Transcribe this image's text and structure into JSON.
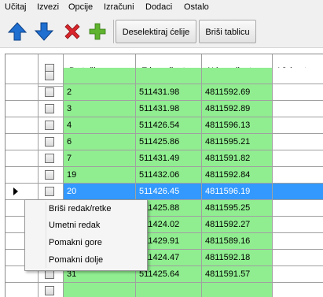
{
  "menu": [
    "Učitaj",
    "Izvezi",
    "Opcije",
    "Izračuni",
    "Dodaci",
    "Ostalo"
  ],
  "toolbar": {
    "icons": [
      "arrow-up-icon",
      "arrow-down-icon",
      "delete-x-icon",
      "add-plus-icon"
    ],
    "deselect_label": "Deselektiraj ćelije",
    "clear_label": "Briši tablicu"
  },
  "table": {
    "columns": [
      "Br. točke",
      "E koordinata",
      "N koordinata",
      "Visina terena"
    ],
    "rows": [
      {
        "id": "",
        "e": "",
        "n": "",
        "h": "",
        "state": "green"
      },
      {
        "id": "2",
        "e": "511431.98",
        "n": "4811592.69",
        "h": "",
        "state": "green"
      },
      {
        "id": "3",
        "e": "511431.98",
        "n": "4811592.89",
        "h": "",
        "state": "green"
      },
      {
        "id": "4",
        "e": "511426.54",
        "n": "4811596.13",
        "h": "",
        "state": "green"
      },
      {
        "id": "6",
        "e": "511425.86",
        "n": "4811595.21",
        "h": "",
        "state": "green"
      },
      {
        "id": "7",
        "e": "511431.49",
        "n": "4811591.82",
        "h": "",
        "state": "green"
      },
      {
        "id": "19",
        "e": "511432.06",
        "n": "4811592.84",
        "h": "",
        "state": "green"
      },
      {
        "id": "20",
        "e": "511426.45",
        "n": "4811596.19",
        "h": "",
        "state": "selected"
      },
      {
        "id": "",
        "e": "511425.88",
        "n": "4811595.25",
        "h": "",
        "state": "green"
      },
      {
        "id": "",
        "e": "511424.02",
        "n": "4811592.27",
        "h": "",
        "state": "green"
      },
      {
        "id": "",
        "e": "511429.91",
        "n": "4811589.16",
        "h": "",
        "state": "green"
      },
      {
        "id": "",
        "e": "511424.47",
        "n": "4811592.18",
        "h": "",
        "state": "green"
      },
      {
        "id": "31",
        "e": "511425.64",
        "n": "4811591.57",
        "h": "",
        "state": "green"
      },
      {
        "id": "",
        "e": "",
        "n": "",
        "h": "",
        "state": "green"
      }
    ]
  },
  "context_menu": [
    "Briši redak/retke",
    "Umetni redak",
    "Pomakni gore",
    "Pomakni dolje"
  ],
  "colors": {
    "row_green": "#90ee90",
    "row_selected": "#3399ff"
  }
}
